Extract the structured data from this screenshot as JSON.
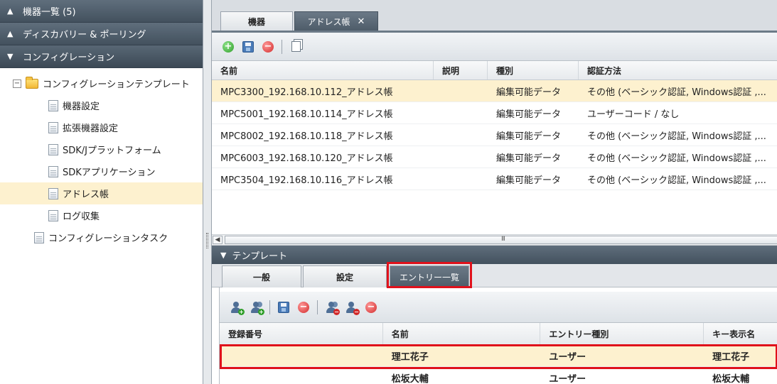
{
  "sidebar": {
    "sections": [
      {
        "label": "機器一覧 (5)",
        "state": "collapsed"
      },
      {
        "label": "ディスカバリー & ポーリング",
        "state": "collapsed"
      },
      {
        "label": "コンフィグレーション",
        "state": "expanded"
      }
    ],
    "tree": {
      "root": {
        "label": "コンフィグレーションテンプレート",
        "toggle": "⊟"
      },
      "children": [
        "機器設定",
        "拡張機器設定",
        "SDK/Jプラットフォーム",
        "SDKアプリケーション",
        "アドレス帳",
        "ログ収集"
      ],
      "selected_child": "アドレス帳",
      "sibling": "コンフィグレーションタスク"
    }
  },
  "tabs": {
    "device": "機器",
    "address_book": "アドレス帳",
    "close_glyph": "✕"
  },
  "table": {
    "columns": [
      "名前",
      "説明",
      "種別",
      "認証方法"
    ],
    "rows": [
      {
        "name": "MPC3300_192.168.10.112_アドレス帳",
        "desc": "",
        "type": "編集可能データ",
        "auth": "その他 (ベーシック認証, Windows認証 ,..."
      },
      {
        "name": "MPC5001_192.168.10.114_アドレス帳",
        "desc": "",
        "type": "編集可能データ",
        "auth": "ユーザーコード / なし"
      },
      {
        "name": "MPC8002_192.168.10.118_アドレス帳",
        "desc": "",
        "type": "編集可能データ",
        "auth": "その他 (ベーシック認証, Windows認証 ,..."
      },
      {
        "name": "MPC6003_192.168.10.120_アドレス帳",
        "desc": "",
        "type": "編集可能データ",
        "auth": "その他 (ベーシック認証, Windows認証 ,..."
      },
      {
        "name": "MPC3504_192.168.10.116_アドレス帳",
        "desc": "",
        "type": "編集可能データ",
        "auth": "その他 (ベーシック認証, Windows認証 ,..."
      }
    ],
    "selected_row": 0,
    "scroll_thumb_text": "III"
  },
  "template_panel": {
    "title": "テンプレート",
    "subtabs": [
      "一般",
      "設定",
      "エントリー一覧"
    ],
    "active_subtab": "エントリー一覧",
    "entry_columns": [
      "登録番号",
      "名前",
      "エントリー種別",
      "キー表示名"
    ],
    "entries": [
      {
        "number": "",
        "name": "理工花子",
        "kind": "ユーザー",
        "key": "理工花子"
      },
      {
        "number": "",
        "name": "松坂大輔",
        "kind": "ユーザー",
        "key": "松坂大輔"
      }
    ]
  },
  "icons": {
    "toolbar": [
      "add-icon",
      "save-icon",
      "delete-icon",
      "copy-icon"
    ],
    "entry_toolbar": [
      "add-user-icon",
      "add-group-icon",
      "save-icon",
      "delete-icon",
      "delete-group-icon",
      "delete-user-icon",
      "remove-icon"
    ]
  },
  "colors": {
    "header_dark": "#4b5966",
    "selection": "#fdf1cf",
    "highlight_red": "#e0111b"
  }
}
